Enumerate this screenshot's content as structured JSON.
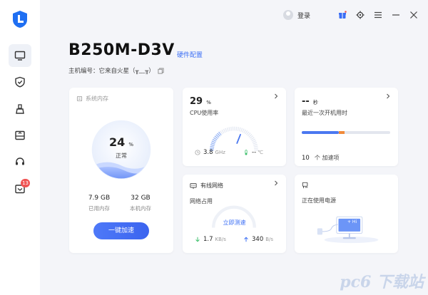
{
  "app": {
    "accent": "#3b6ef5"
  },
  "sidebar": {
    "badge_count": "13",
    "items": [
      {
        "icon": "monitor-icon",
        "active": true
      },
      {
        "icon": "shield-check-icon",
        "active": false
      },
      {
        "icon": "broom-icon",
        "active": false
      },
      {
        "icon": "drive-box-icon",
        "active": false
      },
      {
        "icon": "headset-icon",
        "active": false
      },
      {
        "icon": "message-box-icon",
        "active": false
      }
    ]
  },
  "topbar": {
    "login_label": "登录",
    "icons": [
      "gift-box-icon",
      "gear-icon",
      "menu-icon",
      "minimize-icon",
      "close-icon"
    ]
  },
  "header": {
    "model": "B250M-D3V",
    "hardware_link": "硬件配置",
    "host_label": "主机编号：",
    "host_value": "它来自火星（╥﹏╥）"
  },
  "memory": {
    "title": "系统内存",
    "percent_value": "24",
    "percent_unit": "%",
    "status": "正常",
    "used_value": "7.9 GB",
    "used_label": "已用内存",
    "total_value": "32 GB",
    "total_label": "本机内存",
    "boost_button": "一键加速"
  },
  "cpu": {
    "percent_value": "29",
    "percent_unit": "%",
    "label": "CPU使用率",
    "freq_value": "3.8",
    "freq_unit": "GHz",
    "temp_value": "--",
    "temp_unit": "℃",
    "usage": 0.29
  },
  "boot": {
    "value": "--",
    "unit": "秒",
    "label": "最近一次开机用时",
    "items_count": "10",
    "items_label": "个 加速项",
    "progress_blue": 0.42,
    "progress_orange": 0.06
  },
  "network": {
    "title": "有线网络",
    "label": "网络占用",
    "speedtest": "立即测速",
    "down_value": "1.7",
    "down_unit": "KB/s",
    "up_value": "340",
    "up_unit": "B/s"
  },
  "power": {
    "label": "正在使用电源",
    "screen_text": "+ Hi"
  },
  "watermark": {
    "text": "pc6 下载站"
  }
}
